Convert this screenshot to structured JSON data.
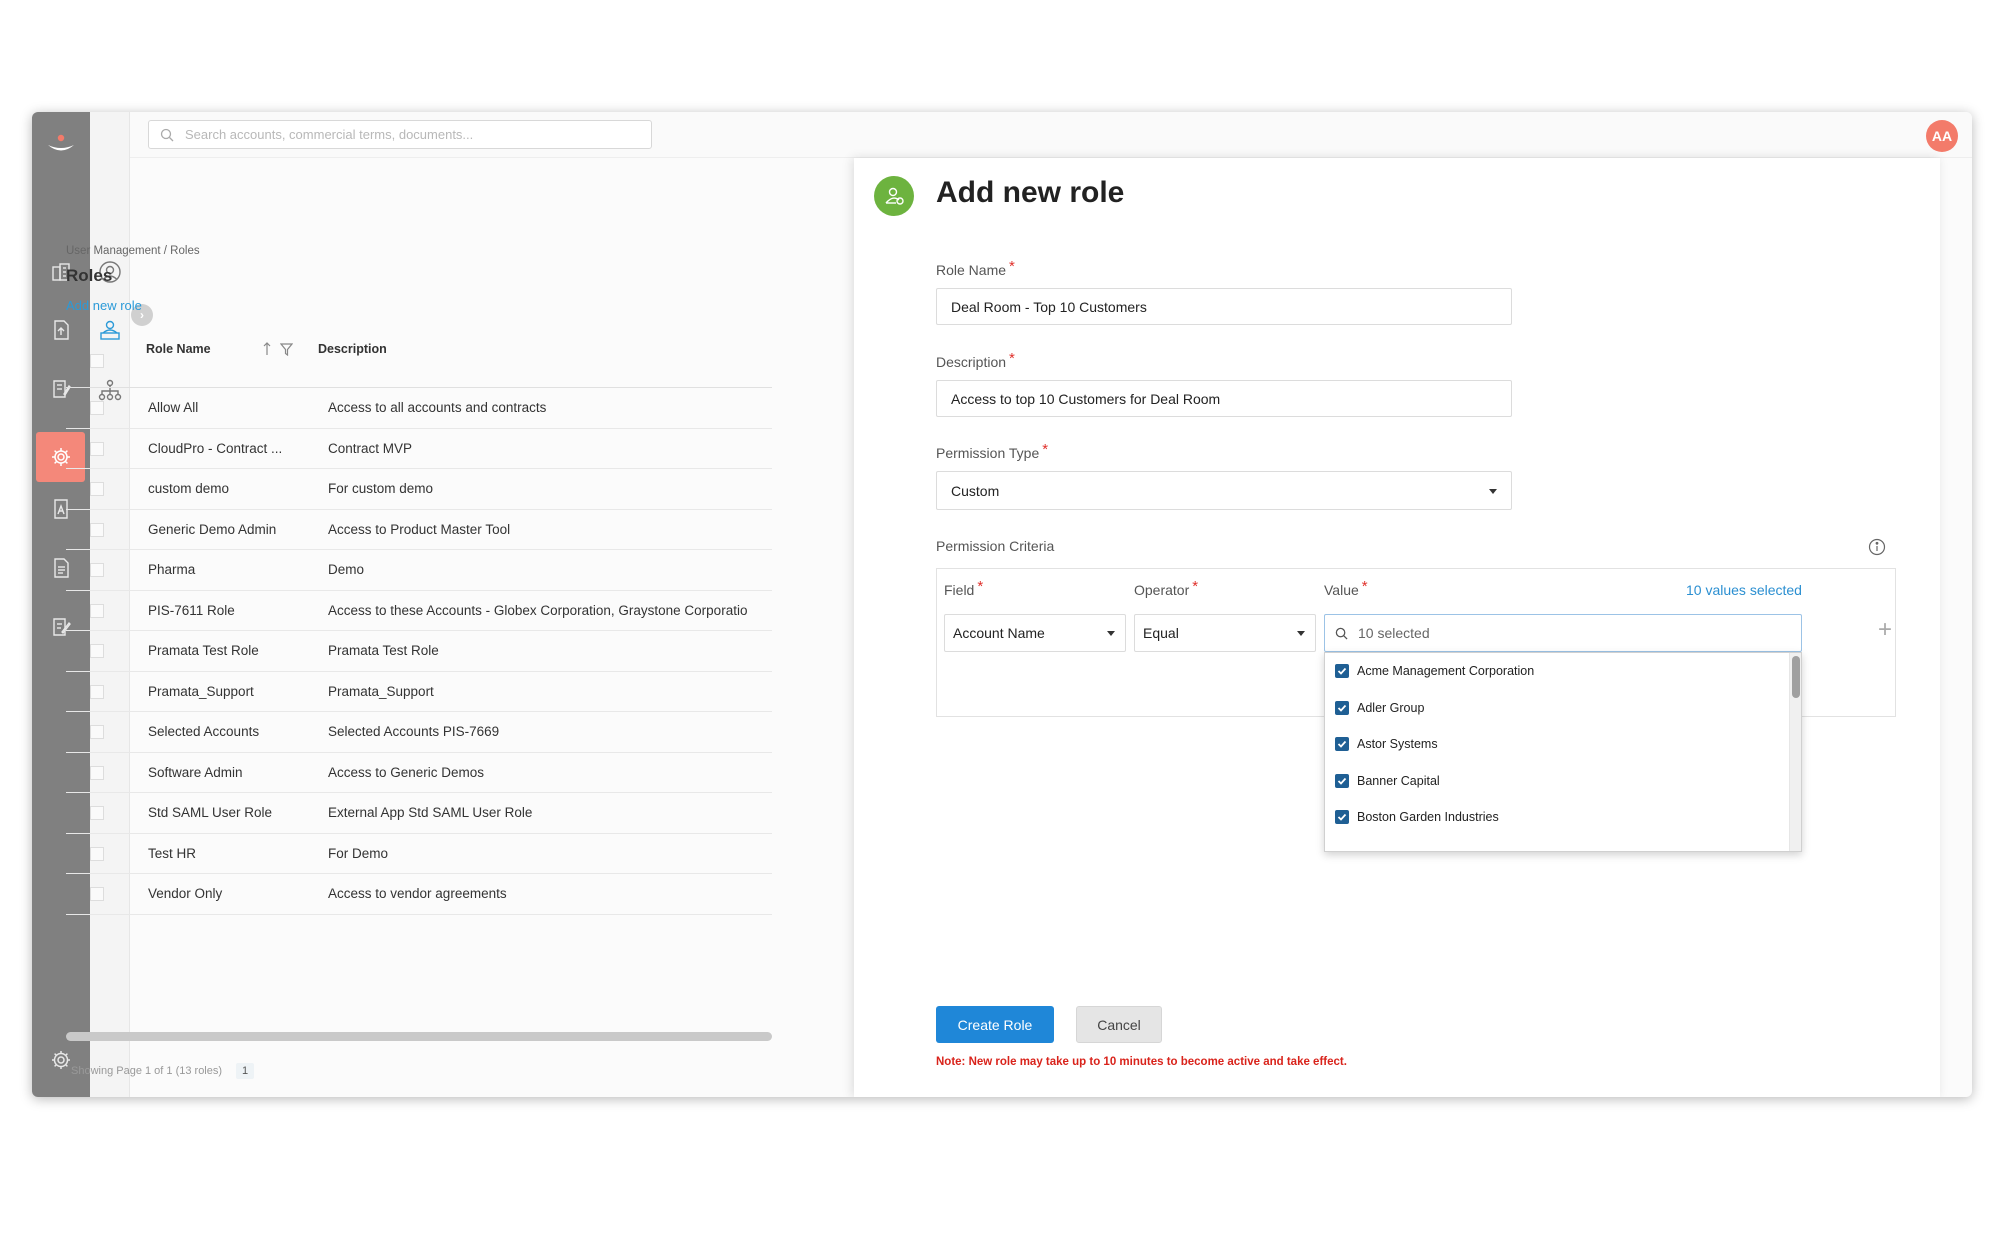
{
  "search": {
    "placeholder": "Search accounts, commercial terms, documents..."
  },
  "user": {
    "initials": "AA"
  },
  "breadcrumb": "User Management / Roles",
  "page_title": "Roles",
  "add_link": "Add new role",
  "table": {
    "columns": [
      "Role Name",
      "Description"
    ],
    "rows": [
      {
        "name": "Allow All",
        "description": "Access to all accounts and contracts"
      },
      {
        "name": "CloudPro - Contract ...",
        "description": "Contract MVP"
      },
      {
        "name": "custom demo",
        "description": "For custom demo"
      },
      {
        "name": "Generic Demo Admin",
        "description": "Access to Product Master Tool"
      },
      {
        "name": "Pharma",
        "description": "Demo"
      },
      {
        "name": "PIS-7611 Role",
        "description": "Access to these Accounts - Globex Corporation, Graystone Corporatio"
      },
      {
        "name": "Pramata Test Role",
        "description": "Pramata Test Role"
      },
      {
        "name": "Pramata_Support",
        "description": "Pramata_Support"
      },
      {
        "name": "Selected Accounts",
        "description": "Selected Accounts PIS-7669"
      },
      {
        "name": "Software Admin",
        "description": "Access to Generic Demos"
      },
      {
        "name": "Std SAML User Role",
        "description": "External App Std SAML User Role"
      },
      {
        "name": "Test HR",
        "description": "For Demo"
      },
      {
        "name": "Vendor Only",
        "description": "Access to vendor agreements"
      }
    ]
  },
  "pager": {
    "text": "Showing Page 1 of 1 (13 roles)",
    "page": "1"
  },
  "panel": {
    "title": "Add new role",
    "role_name_label": "Role Name",
    "role_name_value": "Deal Room - Top 10 Customers",
    "description_label": "Description",
    "description_value": "Access to top 10 Customers for Deal Room",
    "permission_type_label": "Permission Type",
    "permission_type_value": "Custom",
    "criteria_label": "Permission Criteria",
    "field_label": "Field",
    "field_value": "Account Name",
    "operator_label": "Operator",
    "operator_value": "Equal",
    "value_label": "Value",
    "values_selected": "10 values selected",
    "value_input": "10 selected",
    "options": [
      "Acme Management Corporation",
      "Adler Group",
      "Astor Systems",
      "Banner Capital",
      "Boston Garden Industries"
    ],
    "create_button": "Create Role",
    "cancel_button": "Cancel",
    "note": "Note: New role may take up to 10 minutes to become active and take effect."
  },
  "colors": {
    "primary": "#1f87d8",
    "accent": "#f4887a",
    "link": "#2b9ad8",
    "success": "#6db33f",
    "required": "#e0302b"
  }
}
